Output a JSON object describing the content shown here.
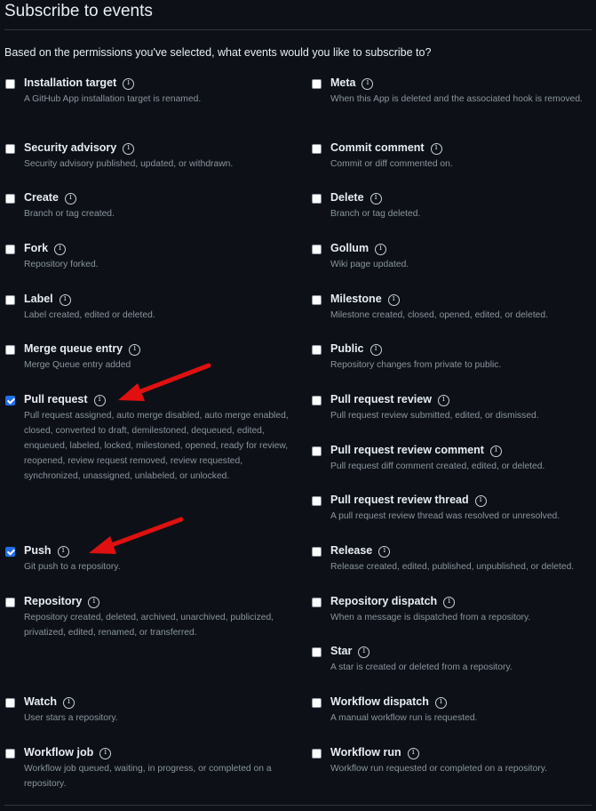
{
  "title": "Subscribe to events",
  "intro": "Based on the permissions you've selected, what events would you like to subscribe to?",
  "events": [
    {
      "name": "Installation target",
      "desc": "A GitHub App installation target is renamed.",
      "checked": false
    },
    {
      "name": "Meta",
      "desc": "When this App is deleted and the associated hook is removed.",
      "checked": false
    },
    {
      "name": "Security advisory",
      "desc": "Security advisory published, updated, or withdrawn.",
      "checked": false
    },
    {
      "name": "Commit comment",
      "desc": "Commit or diff commented on.",
      "checked": false
    },
    {
      "name": "Create",
      "desc": "Branch or tag created.",
      "checked": false
    },
    {
      "name": "Delete",
      "desc": "Branch or tag deleted.",
      "checked": false
    },
    {
      "name": "Fork",
      "desc": "Repository forked.",
      "checked": false
    },
    {
      "name": "Gollum",
      "desc": "Wiki page updated.",
      "checked": false
    },
    {
      "name": "Label",
      "desc": "Label created, edited or deleted.",
      "checked": false
    },
    {
      "name": "Milestone",
      "desc": "Milestone created, closed, opened, edited, or deleted.",
      "checked": false
    },
    {
      "name": "Merge queue entry",
      "desc": "Merge Queue entry added",
      "checked": false
    },
    {
      "name": "Public",
      "desc": "Repository changes from private to public.",
      "checked": false
    },
    {
      "name": "Pull request",
      "desc": "Pull request assigned, auto merge disabled, auto merge enabled, closed, converted to draft, demilestoned, dequeued, edited, enqueued, labeled, locked, milestoned, opened, ready for review, reopened, review request removed, review requested, synchronized, unassigned, unlabeled, or unlocked.",
      "checked": true
    },
    {
      "name": "Pull request review",
      "desc": "Pull request review submitted, edited, or dismissed.",
      "checked": false
    },
    {
      "name": "Pull request review comment",
      "desc": "Pull request diff comment created, edited, or deleted.",
      "checked": false
    },
    {
      "name": "Pull request review thread",
      "desc": "A pull request review thread was resolved or unresolved.",
      "checked": false
    },
    {
      "name": "Push",
      "desc": "Git push to a repository.",
      "checked": true
    },
    {
      "name": "Release",
      "desc": "Release created, edited, published, unpublished, or deleted.",
      "checked": false
    },
    {
      "name": "Repository",
      "desc": "Repository created, deleted, archived, unarchived, publicized, privatized, edited, renamed, or transferred.",
      "checked": false
    },
    {
      "name": "Repository dispatch",
      "desc": "When a message is dispatched from a repository.",
      "checked": false
    },
    {
      "name": "Star",
      "desc": "A star is created or deleted from a repository.",
      "checked": false
    },
    {
      "name": "Watch",
      "desc": "User stars a repository.",
      "checked": false
    },
    {
      "name": "Workflow dispatch",
      "desc": "A manual workflow run is requested.",
      "checked": false
    },
    {
      "name": "Workflow job",
      "desc": "Workflow job queued, waiting, in progress, or completed on a repository.",
      "checked": false
    },
    {
      "name": "Workflow run",
      "desc": "Workflow run requested or completed on a repository.",
      "checked": false
    }
  ],
  "annotation_color": "#e01010"
}
